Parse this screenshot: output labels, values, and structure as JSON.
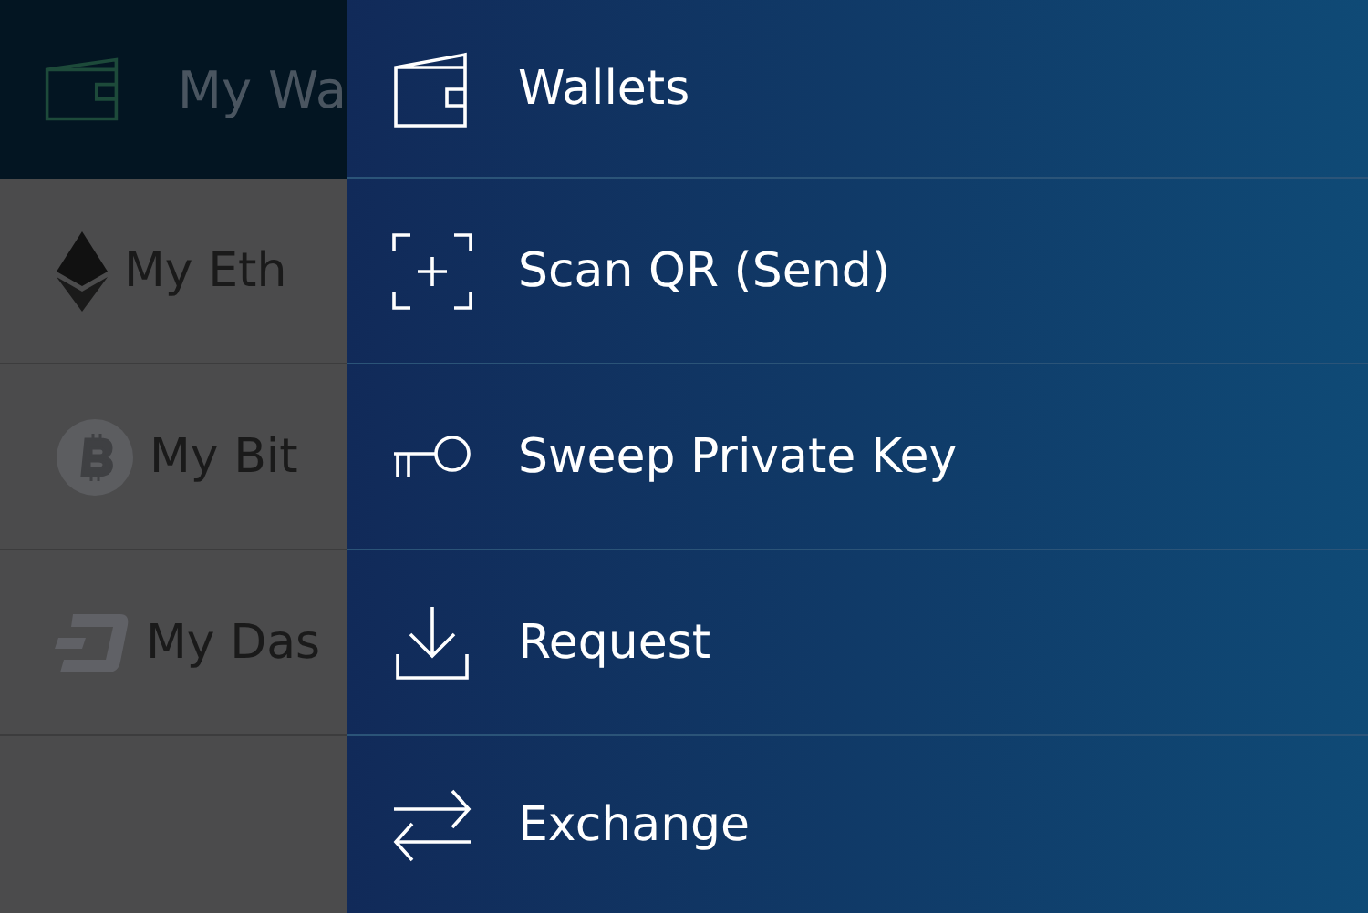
{
  "background": {
    "header": {
      "title": "My Wa"
    },
    "wallets": [
      {
        "name": "My Eth"
      },
      {
        "name": "My Bit"
      },
      {
        "name": "My Das"
      }
    ]
  },
  "menu": {
    "items": [
      {
        "label": "Wallets"
      },
      {
        "label": "Scan QR (Send)"
      },
      {
        "label": "Sweep Private Key"
      },
      {
        "label": "Request"
      },
      {
        "label": "Exchange"
      }
    ]
  }
}
